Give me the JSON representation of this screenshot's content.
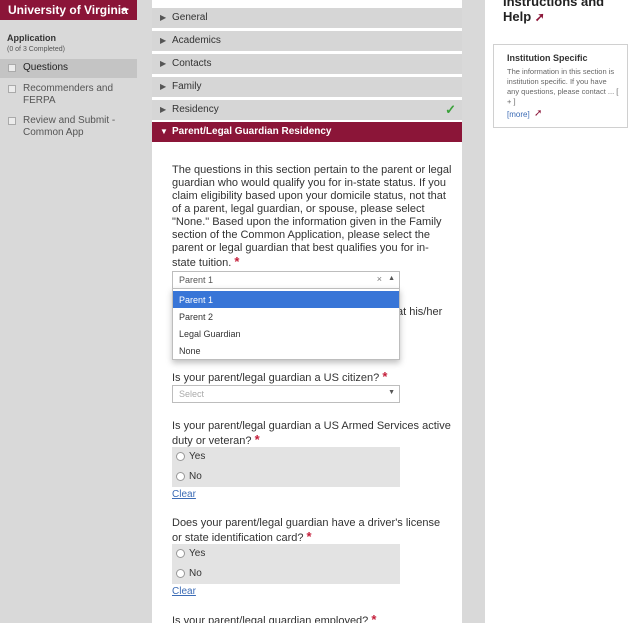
{
  "sidebar": {
    "college_name": "University of Virginia",
    "collapse_glyph": "−",
    "app_heading": "Application",
    "completed_text": "(0 of 3 Completed)",
    "items": [
      {
        "label": "Questions"
      },
      {
        "label_line1": "Recommenders and",
        "label_line2": "FERPA"
      },
      {
        "label_line1": "Review and Submit -",
        "label_line2": "Common App"
      }
    ]
  },
  "sections": [
    {
      "label": "General"
    },
    {
      "label": "Academics"
    },
    {
      "label": "Contacts"
    },
    {
      "label": "Family"
    },
    {
      "label": "Residency",
      "status": "complete"
    }
  ],
  "active_section": {
    "label": "Parent/Legal Guardian Residency"
  },
  "questions": {
    "intro": {
      "text": "The questions in this section pertain to the parent or legal guardian who would qualify you for in-state status. If you claim eligibility based upon your domicile status, not that of a parent, legal guardian, or spouse, please select \"None.\" Based upon the information given in the Family section of the Common Application, please select the parent or legal guardian that best qualifies you for in-state tuition.",
      "required_mark": "*",
      "selected_value": "Parent 1",
      "clear_glyph": "×",
      "arrow_glyph": "▲",
      "options": [
        "Parent 1",
        "Parent 2",
        "Legal Guardian",
        "None"
      ]
    },
    "obscured_fragment": "at his/her",
    "us_citizen": {
      "text": "Is your parent/legal guardian a US citizen?",
      "required_mark": "*",
      "placeholder": "Select",
      "arrow_glyph": "▼"
    },
    "armed_services": {
      "text": "Is your parent/legal guardian a US Armed Services active duty or veteran?",
      "required_mark": "*",
      "options": [
        "Yes",
        "No"
      ],
      "clear_label": "Clear"
    },
    "drivers_license": {
      "text": "Does your parent/legal guardian have a driver's license or state identification card?",
      "required_mark": "*",
      "options": [
        "Yes",
        "No"
      ],
      "clear_label": "Clear"
    },
    "employed": {
      "text": "Is your parent/legal guardian employed?",
      "required_mark": "*"
    }
  },
  "help": {
    "title_line1": "Instructions and",
    "title_line2": "Help",
    "card_title": "Institution Specific",
    "card_body": "The information in this section is institution specific. If you have any questions, please contact ... [ + ]",
    "more_label": "[more]"
  },
  "colors": {
    "brand": "#8b1538",
    "dropdown_highlight": "#3875d7",
    "success": "#3aa13a",
    "link": "#3b6bb5"
  }
}
